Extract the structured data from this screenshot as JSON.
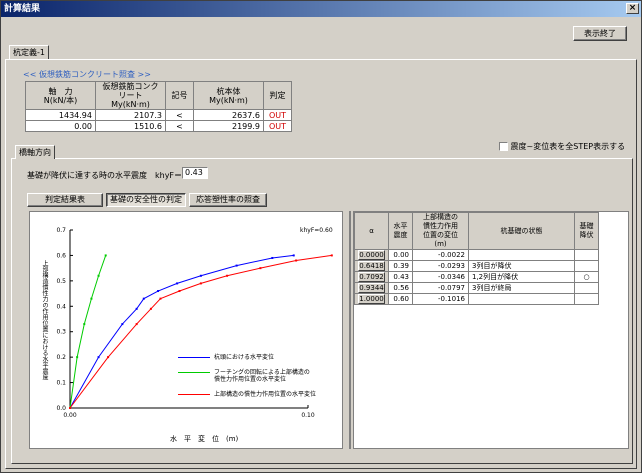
{
  "window": {
    "title": "計算結果",
    "close_glyph": "×"
  },
  "top_button": "表示終了",
  "pile_tab": "杭定義-1",
  "section_title": "<< 仮想鉄筋コンクリート照査 >>",
  "rc_table": {
    "headers": [
      "軸　力\nN(kN/本)",
      "仮想鉄筋コンクリート\nMy(kN·m)",
      "記号",
      "杭本体\nMy(kN·m)",
      "判定"
    ],
    "rows": [
      {
        "n": "1434.94",
        "my_rc": "2107.3",
        "sym": "<",
        "my_pile": "2637.6",
        "result": "OUT"
      },
      {
        "n": "0.00",
        "my_rc": "1510.6",
        "sym": "<",
        "my_pile": "2199.9",
        "result": "OUT"
      }
    ]
  },
  "direction_tab": "橋軸方向",
  "show_all_label": "震度~変位表を全STEP表示する",
  "khyf": {
    "label": "基礎が降伏に達する時の水平震度　khyF＝",
    "value": "0.43"
  },
  "subtabs": [
    "判定結果表",
    "基礎の安全性の判定",
    "応答塑性率の照査"
  ],
  "chart_data": {
    "type": "line",
    "ylabel": "上部構造慣性力の作用位置における水平震度",
    "xlabel": "水　平　変　位　(m)",
    "annotation": "khyF=0.60",
    "x_ticks": [
      "0.00",
      "0.10"
    ],
    "y_ticks": [
      "0.0",
      "0.1",
      "0.2",
      "0.3",
      "0.4",
      "0.5",
      "0.6",
      "0.7"
    ],
    "xlim": [
      0,
      0.1
    ],
    "ylim": [
      0,
      0.7
    ],
    "series": [
      {
        "name": "杭頭における水平変位",
        "color": "#0000ff",
        "points": [
          [
            0,
            0
          ],
          [
            0.012,
            0.2
          ],
          [
            0.022,
            0.33
          ],
          [
            0.028,
            0.39
          ],
          [
            0.031,
            0.43
          ],
          [
            0.037,
            0.46
          ],
          [
            0.045,
            0.49
          ],
          [
            0.055,
            0.52
          ],
          [
            0.07,
            0.56
          ],
          [
            0.085,
            0.59
          ],
          [
            0.094,
            0.6
          ]
        ]
      },
      {
        "name": "フーチングの回転による上部構造の慣性力作用位置の水平変位",
        "color": "#00cc00",
        "points": [
          [
            0,
            0
          ],
          [
            0.003,
            0.2
          ],
          [
            0.006,
            0.33
          ],
          [
            0.009,
            0.43
          ],
          [
            0.012,
            0.52
          ],
          [
            0.015,
            0.6
          ]
        ]
      },
      {
        "name": "上部構造の慣性力作用位置の水平変位",
        "color": "#ff0000",
        "points": [
          [
            0,
            0
          ],
          [
            0.016,
            0.2
          ],
          [
            0.028,
            0.33
          ],
          [
            0.034,
            0.39
          ],
          [
            0.038,
            0.43
          ],
          [
            0.046,
            0.46
          ],
          [
            0.055,
            0.49
          ],
          [
            0.066,
            0.52
          ],
          [
            0.08,
            0.55
          ],
          [
            0.095,
            0.58
          ],
          [
            0.11,
            0.6
          ]
        ]
      }
    ]
  },
  "result_table": {
    "headers": [
      "α",
      "水平\n震度",
      "上部構造の\n慣性力作用\n位置の変位\n(m)",
      "杭基礎の状態",
      "基礎\n降伏"
    ],
    "rows": [
      {
        "alpha": "0.0000",
        "k": "0.00",
        "disp": "-0.0022",
        "state": "",
        "yield": ""
      },
      {
        "alpha": "0.6418",
        "k": "0.39",
        "disp": "-0.0293",
        "state": "3列目が降伏",
        "yield": ""
      },
      {
        "alpha": "0.7092",
        "k": "0.43",
        "disp": "-0.0346",
        "state": "1,2列目が降伏",
        "yield": "○"
      },
      {
        "alpha": "0.9344",
        "k": "0.56",
        "disp": "-0.0797",
        "state": "3列目が終局",
        "yield": ""
      },
      {
        "alpha": "1.0000",
        "k": "0.60",
        "disp": "-0.1016",
        "state": "",
        "yield": ""
      }
    ]
  }
}
